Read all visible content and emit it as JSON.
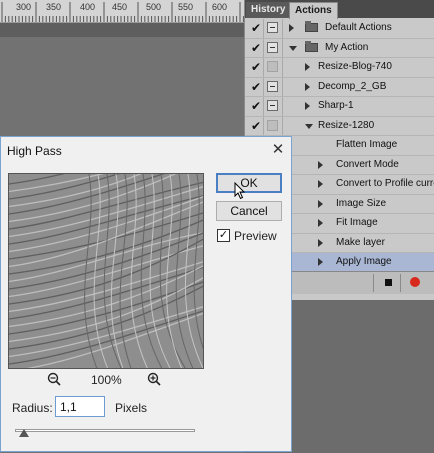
{
  "ruler": {
    "labels": [
      "300",
      "350",
      "400",
      "450",
      "500",
      "550",
      "600"
    ]
  },
  "panel": {
    "tabs": [
      {
        "label": "History"
      },
      {
        "label": "Actions"
      }
    ],
    "actions": [
      {
        "label": "Default Actions",
        "checked": true,
        "dialog": "on",
        "kind": "set",
        "expanded": false
      },
      {
        "label": "My Action",
        "checked": true,
        "dialog": "on",
        "kind": "set",
        "expanded": true
      },
      {
        "label": "Resize-Blog-740",
        "checked": true,
        "dialog": "off",
        "kind": "action"
      },
      {
        "label": "Decomp_2_GB",
        "checked": true,
        "dialog": "on",
        "kind": "action"
      },
      {
        "label": "Sharp-1",
        "checked": true,
        "dialog": "on",
        "kind": "action"
      },
      {
        "label": "Resize-1280",
        "checked": true,
        "dialog": "off",
        "kind": "action",
        "expanded": true
      },
      {
        "label": "Flatten Image",
        "checked": false,
        "dialog": "none",
        "kind": "step"
      },
      {
        "label": "Convert Mode",
        "checked": false,
        "dialog": "none",
        "kind": "step-expandable"
      },
      {
        "label": "Convert to Profile curren",
        "checked": false,
        "dialog": "none",
        "kind": "step-expandable"
      },
      {
        "label": "Image Size",
        "checked": false,
        "dialog": "none",
        "kind": "step-expandable"
      },
      {
        "label": "Fit Image",
        "checked": false,
        "dialog": "none",
        "kind": "step-expandable"
      },
      {
        "label": "Make layer",
        "checked": false,
        "dialog": "none",
        "kind": "step-expandable"
      },
      {
        "label": "Apply Image",
        "checked": false,
        "dialog": "none",
        "kind": "step-expandable",
        "selected": true
      }
    ]
  },
  "dialog": {
    "title": "High Pass",
    "ok_label": "OK",
    "cancel_label": "Cancel",
    "preview_label": "Preview",
    "preview_checked": true,
    "zoom_level": "100%",
    "radius_label": "Radius:",
    "radius_value": "1,1",
    "units_label": "Pixels",
    "slider_fraction": 0.05
  },
  "colors": {
    "selection": "#a9b7d4",
    "record": "#d82a1c",
    "default_button_border": "#4a7fc4"
  }
}
